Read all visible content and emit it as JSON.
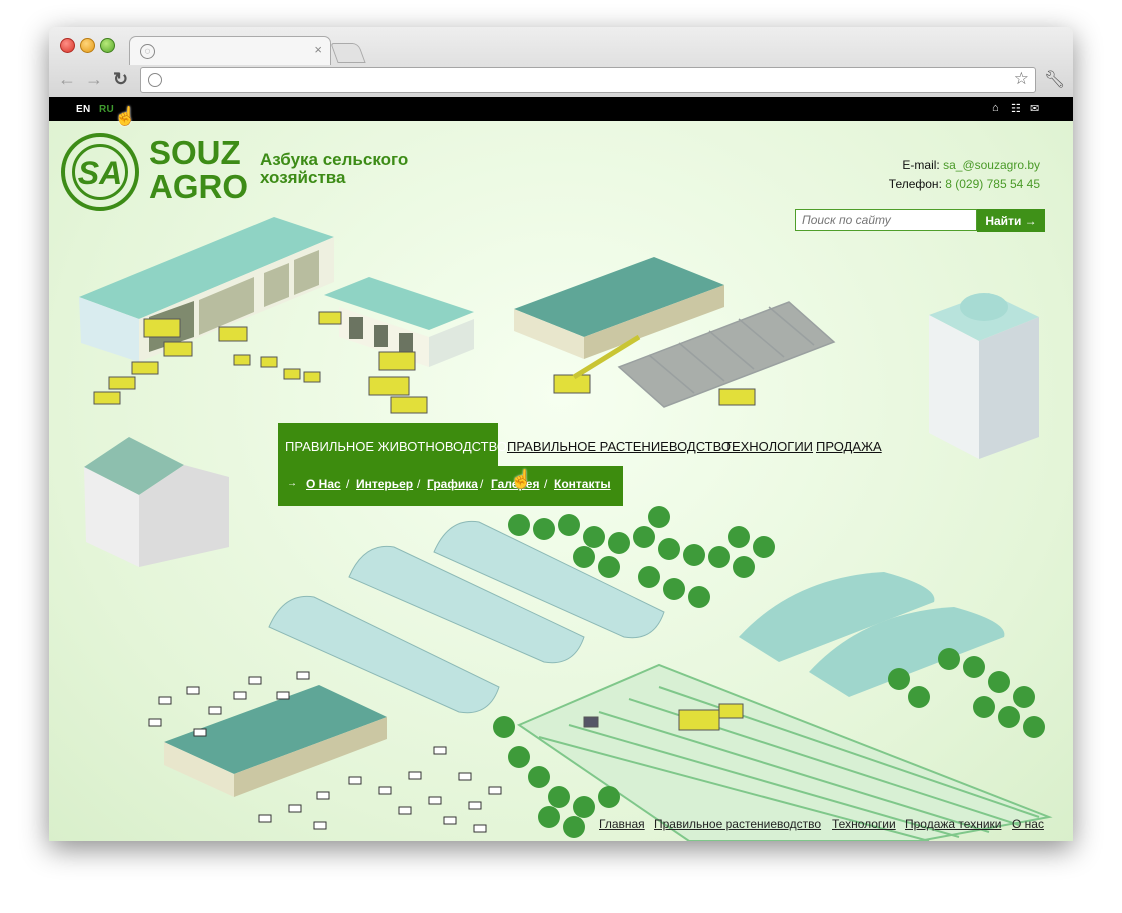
{
  "browser": {
    "address": "",
    "tab_title": ""
  },
  "topbar": {
    "lang_en": "EN",
    "lang_ru": "RU"
  },
  "logo": {
    "monogram": "SA",
    "word1": "SOUZ",
    "word2": "AGRO"
  },
  "tagline": "Азбука сельского хозяйства",
  "contact": {
    "email_label": "E-mail:",
    "email": "sa_@souzagro.by",
    "phone_label": "Телефон:",
    "phone": "8 (029) 785 54 45"
  },
  "search": {
    "placeholder": "Поиск по сайту",
    "button": "Найти →"
  },
  "main_menu": {
    "items": [
      "ПРАВИЛЬНОЕ ЖИВОТНОВОДСТВО",
      "ПРАВИЛЬНОЕ РАСТЕНИЕВОДСТВО",
      "ТЕХНОЛОГИИ",
      "ПРОДАЖА"
    ]
  },
  "sub_menu": {
    "arrow": "→",
    "items": [
      "О Нас",
      "Интерьер",
      "Графика",
      "Галерея",
      "Контакты"
    ],
    "separator": "/"
  },
  "footer_nav": {
    "items": [
      "Главная",
      "Правильное растениеводство",
      "Технологии",
      "Продажа техники",
      "О нас"
    ]
  },
  "colors": {
    "brand_green": "#3d8c17",
    "menu_green": "#3d8c0e",
    "topbar": "#000000",
    "background": "#e4f5d8"
  },
  "icons": [
    "home-icon",
    "sitemap-icon",
    "mail-icon",
    "back-icon",
    "forward-icon",
    "reload-icon",
    "star-icon",
    "wrench-icon",
    "globe-icon"
  ]
}
